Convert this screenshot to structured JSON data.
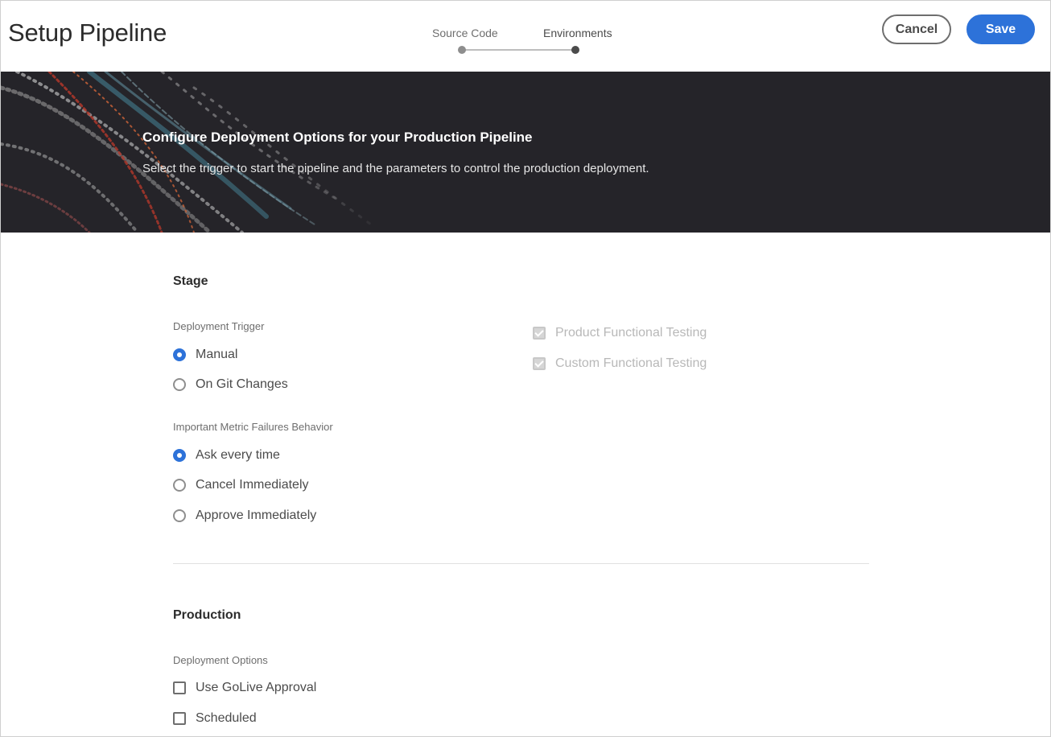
{
  "header": {
    "title": "Setup Pipeline",
    "steps": [
      "Source Code",
      "Environments"
    ],
    "cancel_label": "Cancel",
    "save_label": "Save"
  },
  "hero": {
    "title": "Configure Deployment Options for your Production Pipeline",
    "subtitle": "Select the trigger to start the pipeline and the parameters to control the production deployment."
  },
  "stage": {
    "title": "Stage",
    "trigger_label": "Deployment Trigger",
    "trigger_options": [
      {
        "label": "Manual",
        "selected": true
      },
      {
        "label": "On Git Changes",
        "selected": false
      }
    ],
    "metric_label": "Important Metric Failures Behavior",
    "metric_options": [
      {
        "label": "Ask every time",
        "selected": true
      },
      {
        "label": "Cancel Immediately",
        "selected": false
      },
      {
        "label": "Approve Immediately",
        "selected": false
      }
    ],
    "testing_options": [
      {
        "label": "Product Functional Testing",
        "checked": true,
        "disabled": true
      },
      {
        "label": "Custom Functional Testing",
        "checked": true,
        "disabled": true
      }
    ]
  },
  "production": {
    "title": "Production",
    "options_label": "Deployment Options",
    "options": [
      {
        "label": "Use GoLive Approval",
        "checked": false
      },
      {
        "label": "Scheduled",
        "checked": false
      }
    ]
  },
  "colors": {
    "accent": "#2d72d9",
    "hero_bg": "#252429"
  }
}
